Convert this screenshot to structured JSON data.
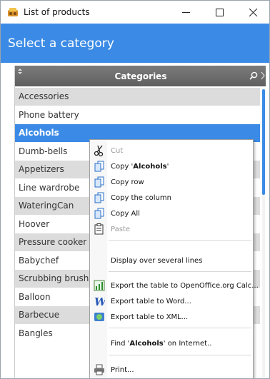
{
  "window": {
    "title": "List of products",
    "icon": "products-app-icon"
  },
  "header": {
    "title": "Select a category"
  },
  "table": {
    "column_header": "Categories",
    "selected_index": 2,
    "rows": [
      "Accessories",
      "Phone battery",
      "Alcohols",
      "Dumb-bells",
      "Appetizers",
      "Line wardrobe",
      "WateringCan",
      "Hoover",
      "Pressure cooker",
      "Babychef",
      "Scrubbing brushes",
      "Balloon",
      "Barbecue",
      "Bangles"
    ]
  },
  "context_menu": {
    "cut": "Cut",
    "copy_prefix": "Copy '",
    "copy_value": "Alcohols",
    "copy_suffix": "'",
    "copy_row": "Copy row",
    "copy_column": "Copy the column",
    "copy_all": "Copy All",
    "paste": "Paste",
    "display_lines": "Display over several lines",
    "export_calc": "Export the table to OpenOffice.org Calc...",
    "export_word": "Export table to Word...",
    "export_xml": "Export table to XML...",
    "find_prefix": "Find '",
    "find_value": "Alcohols",
    "find_suffix": "' on Internet..",
    "print": "Print..."
  },
  "colors": {
    "accent": "#3b8be6",
    "header_gradient": "#6e6e6e",
    "alt_row": "#dcdcdc"
  }
}
